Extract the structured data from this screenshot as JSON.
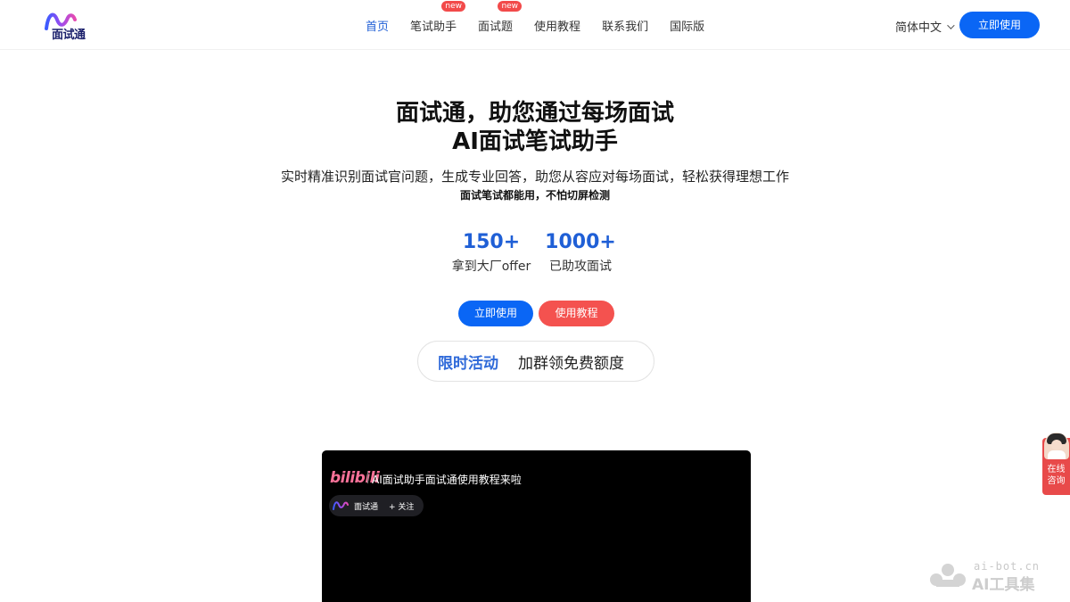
{
  "header": {
    "logo_text": "面试通",
    "nav": [
      {
        "label": "首页",
        "badge": ""
      },
      {
        "label": "笔试助手",
        "badge": "new"
      },
      {
        "label": "面试题",
        "badge": "new"
      },
      {
        "label": "使用教程",
        "badge": ""
      },
      {
        "label": "联系我们",
        "badge": ""
      },
      {
        "label": "国际版",
        "badge": ""
      }
    ],
    "language": "简体中文",
    "cta": "立即使用"
  },
  "hero": {
    "title_line1": "面试通，助您通过每场面试",
    "title_line2": "AI面试笔试助手",
    "description": "实时精准识别面试官问题，生成专业回答，助您从容应对每场面试，轻松获得理想工作",
    "description_bold": "面试笔试都能用，不怕切屏检测",
    "stats": [
      {
        "value": "150+",
        "label": "拿到大厂offer"
      },
      {
        "value": "1000+",
        "label": "已助攻面试"
      }
    ],
    "primary_button": "立即使用",
    "secondary_button": "使用教程",
    "promo": {
      "tag": "限时活动",
      "text": "加群领免费额度"
    }
  },
  "video": {
    "platform": "bilibili",
    "title": "AI面试助手面试通使用教程来啦",
    "channel_name": "面试通",
    "follow_label": "+ 关注"
  },
  "consult": {
    "line1": "在线",
    "line2": "咨询"
  },
  "watermark": {
    "url": "ai-bot.cn",
    "name": "AI工具集"
  },
  "colors": {
    "primary": "#0a66f5",
    "accent_red": "#f4524f",
    "link_blue": "#1f5fd6"
  }
}
